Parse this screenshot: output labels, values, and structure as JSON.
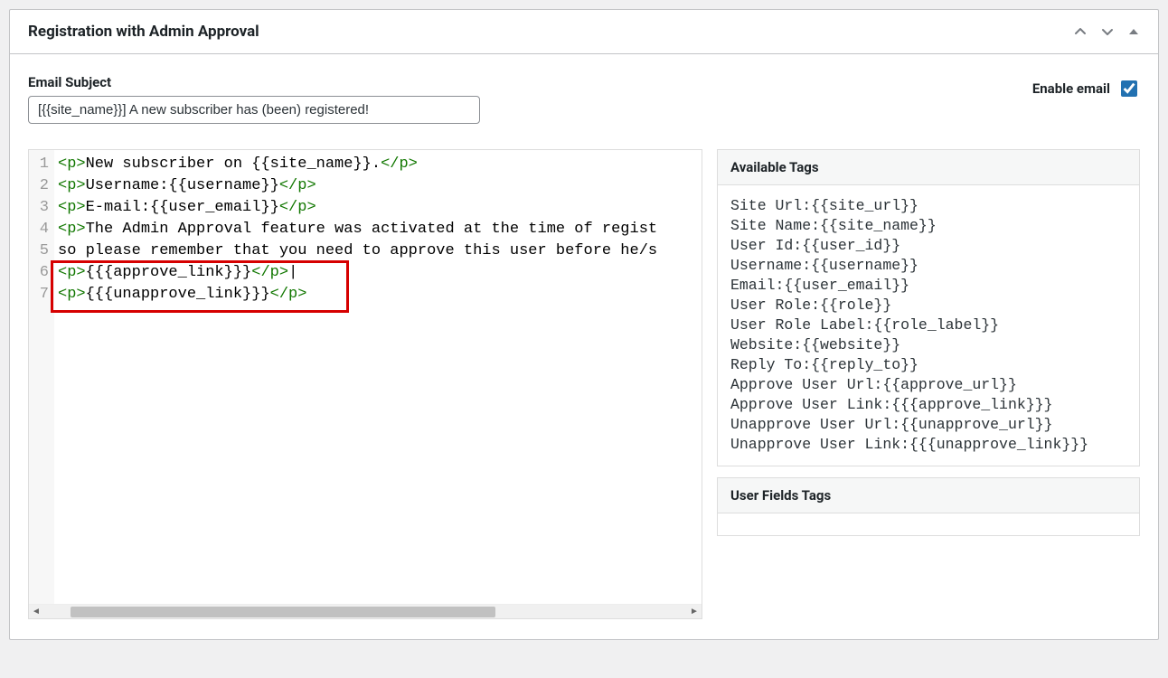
{
  "panel": {
    "title": "Registration with Admin Approval"
  },
  "subject": {
    "label": "Email Subject",
    "value": "[{{site_name}}] A new subscriber has (been) registered!"
  },
  "enable": {
    "label": "Enable email",
    "checked": true
  },
  "code": {
    "lines": [
      {
        "num": "1",
        "segments": [
          {
            "t": "tag",
            "v": "<p>"
          },
          {
            "t": "text",
            "v": "New subscriber on {{site_name}}."
          },
          {
            "t": "tag",
            "v": "</p>"
          }
        ]
      },
      {
        "num": "2",
        "segments": [
          {
            "t": "tag",
            "v": "<p>"
          },
          {
            "t": "text",
            "v": "Username:{{username}}"
          },
          {
            "t": "tag",
            "v": "</p>"
          }
        ]
      },
      {
        "num": "3",
        "segments": [
          {
            "t": "tag",
            "v": "<p>"
          },
          {
            "t": "text",
            "v": "E-mail:{{user_email}}"
          },
          {
            "t": "tag",
            "v": "</p>"
          }
        ]
      },
      {
        "num": "4",
        "segments": [
          {
            "t": "tag",
            "v": "<p>"
          },
          {
            "t": "text",
            "v": "The Admin Approval feature was activated at the time of regist"
          }
        ]
      },
      {
        "num": "5",
        "segments": [
          {
            "t": "text",
            "v": "so please remember that you need to approve this user before he/s"
          }
        ]
      },
      {
        "num": "6",
        "segments": [
          {
            "t": "tag",
            "v": "<p>"
          },
          {
            "t": "text",
            "v": "{{{approve_link}}}"
          },
          {
            "t": "tag",
            "v": "</p>"
          },
          {
            "t": "text",
            "v": "|"
          }
        ]
      },
      {
        "num": "7",
        "segments": [
          {
            "t": "tag",
            "v": "<p>"
          },
          {
            "t": "text",
            "v": "{{{unapprove_link}}}"
          },
          {
            "t": "tag",
            "v": "</p>"
          }
        ]
      }
    ]
  },
  "available_tags": {
    "header": "Available Tags",
    "items": [
      "Site Url:{{site_url}}",
      "Site Name:{{site_name}}",
      "User Id:{{user_id}}",
      "Username:{{username}}",
      "Email:{{user_email}}",
      "User Role:{{role}}",
      "User Role Label:{{role_label}}",
      "Website:{{website}}",
      "Reply To:{{reply_to}}",
      "Approve User Url:{{approve_url}}",
      "Approve User Link:{{{approve_link}}}",
      "Unapprove User Url:{{unapprove_url}}",
      "Unapprove User Link:{{{unapprove_link}}}"
    ]
  },
  "user_fields": {
    "header": "User Fields Tags"
  },
  "highlight": {
    "top_line": 6,
    "bottom_line": 7
  }
}
